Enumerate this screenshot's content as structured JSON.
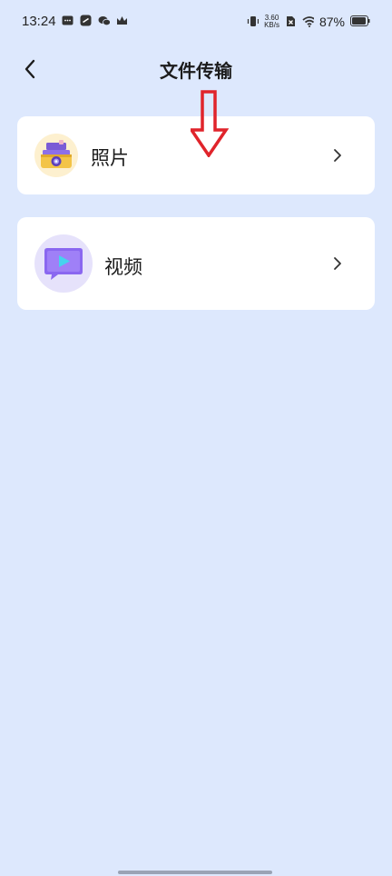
{
  "status_bar": {
    "time": "13:24",
    "net_speed_value": "3.60",
    "net_speed_unit": "KB/s",
    "battery_percent": "87%"
  },
  "header": {
    "title": "文件传输"
  },
  "items": [
    {
      "label": "照片",
      "icon": "photo-box-icon"
    },
    {
      "label": "视频",
      "icon": "video-play-icon"
    }
  ],
  "colors": {
    "background": "#dde8fd",
    "card": "#ffffff",
    "annotation_arrow": "#e0242b"
  }
}
